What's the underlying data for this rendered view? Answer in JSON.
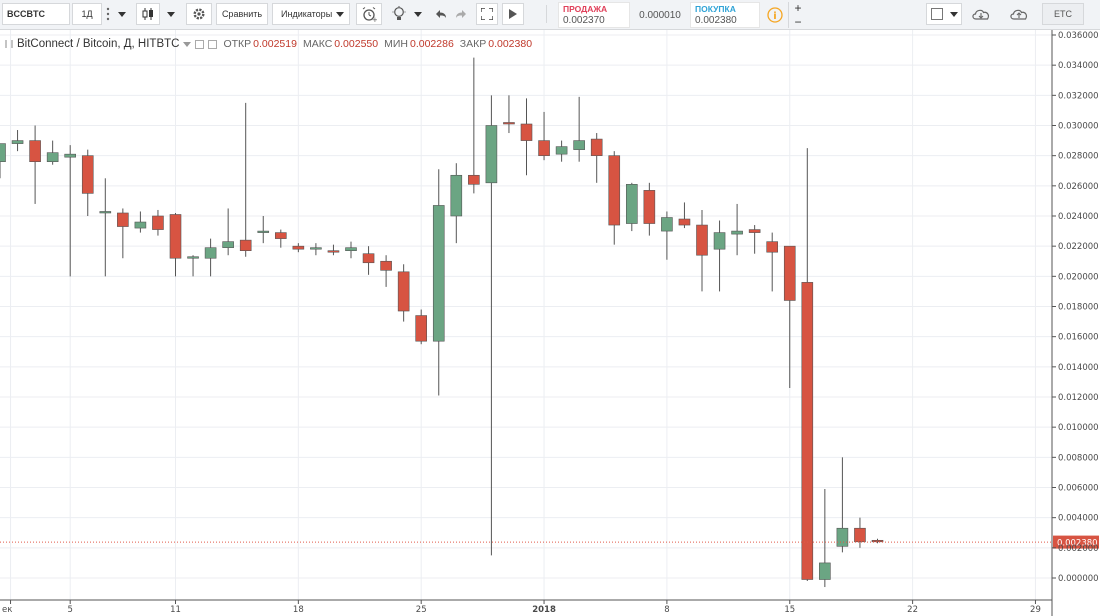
{
  "toolbar": {
    "symbol": "BCCBTC",
    "interval": "1Д",
    "compare_label": "Сравнить",
    "indicators_label": "Индикаторы",
    "sell_label": "ПРОДАЖА",
    "sell_value": "0.002370",
    "spread": "0.000010",
    "buy_label": "ПОКУПКА",
    "buy_value": "0.002380",
    "currency": "ETC",
    "plus": "+",
    "minus": "−"
  },
  "legend": {
    "title": "BitConnect / Bitcoin, Д, HITBTC",
    "open_label": "ОТКР",
    "open_value": "0.002519",
    "high_label": "МАКС",
    "high_value": "0.002550",
    "low_label": "МИН",
    "low_value": "0.002286",
    "close_label": "ЗАКР",
    "close_value": "0.002380"
  },
  "colors": {
    "up": "#6ba583",
    "down": "#d75442",
    "last_price_line": "#e05a4a",
    "grid": "#eceef2"
  },
  "chart_data": {
    "type": "candlestick",
    "title": "BitConnect / Bitcoin, Д, HITBTC",
    "ylim": [
      -0.0005,
      0.0365
    ],
    "y_ticks": [
      "0.036000",
      "0.034000",
      "0.032000",
      "0.030000",
      "0.028000",
      "0.026000",
      "0.024000",
      "0.022000",
      "0.020000",
      "0.018000",
      "0.016000",
      "0.014000",
      "0.012000",
      "0.010000",
      "0.008000",
      "0.006000",
      "0.004000",
      "0.002000",
      "0.000000"
    ],
    "x_ticks": [
      "ек",
      "5",
      "11",
      "18",
      "25",
      "2018",
      "8",
      "15",
      "22",
      "29"
    ],
    "last_price": "0.002380",
    "candles": [
      {
        "o": 0.0276,
        "h": 0.0288,
        "l": 0.0265,
        "c": 0.0288
      },
      {
        "o": 0.0288,
        "h": 0.0297,
        "l": 0.0283,
        "c": 0.029
      },
      {
        "o": 0.029,
        "h": 0.03,
        "l": 0.0248,
        "c": 0.0276
      },
      {
        "o": 0.0276,
        "h": 0.029,
        "l": 0.0274,
        "c": 0.0282
      },
      {
        "o": 0.0279,
        "h": 0.0287,
        "l": 0.02,
        "c": 0.0281
      },
      {
        "o": 0.028,
        "h": 0.0284,
        "l": 0.024,
        "c": 0.0255
      },
      {
        "o": 0.0242,
        "h": 0.0265,
        "l": 0.02,
        "c": 0.0243
      },
      {
        "o": 0.0242,
        "h": 0.0245,
        "l": 0.0212,
        "c": 0.0233
      },
      {
        "o": 0.0232,
        "h": 0.0243,
        "l": 0.0229,
        "c": 0.0236
      },
      {
        "o": 0.024,
        "h": 0.0244,
        "l": 0.0227,
        "c": 0.0231
      },
      {
        "o": 0.0241,
        "h": 0.0242,
        "l": 0.02,
        "c": 0.0212
      },
      {
        "o": 0.0212,
        "h": 0.0214,
        "l": 0.02,
        "c": 0.0213
      },
      {
        "o": 0.0212,
        "h": 0.0225,
        "l": 0.02,
        "c": 0.0219
      },
      {
        "o": 0.0219,
        "h": 0.0245,
        "l": 0.0214,
        "c": 0.0223
      },
      {
        "o": 0.0224,
        "h": 0.0315,
        "l": 0.0213,
        "c": 0.0217
      },
      {
        "o": 0.0229,
        "h": 0.024,
        "l": 0.0222,
        "c": 0.023
      },
      {
        "o": 0.0229,
        "h": 0.0231,
        "l": 0.0219,
        "c": 0.0225
      },
      {
        "o": 0.022,
        "h": 0.0222,
        "l": 0.0216,
        "c": 0.0218
      },
      {
        "o": 0.0218,
        "h": 0.0222,
        "l": 0.0214,
        "c": 0.0219
      },
      {
        "o": 0.0217,
        "h": 0.0221,
        "l": 0.0214,
        "c": 0.0216
      },
      {
        "o": 0.0217,
        "h": 0.0223,
        "l": 0.0212,
        "c": 0.0219
      },
      {
        "o": 0.0215,
        "h": 0.022,
        "l": 0.0201,
        "c": 0.0209
      },
      {
        "o": 0.021,
        "h": 0.0214,
        "l": 0.0193,
        "c": 0.0204
      },
      {
        "o": 0.0203,
        "h": 0.0208,
        "l": 0.017,
        "c": 0.0177
      },
      {
        "o": 0.0174,
        "h": 0.0178,
        "l": 0.0155,
        "c": 0.0157
      },
      {
        "o": 0.0157,
        "h": 0.0271,
        "l": 0.0121,
        "c": 0.0247
      },
      {
        "o": 0.024,
        "h": 0.0275,
        "l": 0.0222,
        "c": 0.0267
      },
      {
        "o": 0.0267,
        "h": 0.0345,
        "l": 0.0255,
        "c": 0.0261
      },
      {
        "o": 0.0262,
        "h": 0.032,
        "l": 0.0015,
        "c": 0.03
      },
      {
        "o": 0.0302,
        "h": 0.032,
        "l": 0.0295,
        "c": 0.0301
      },
      {
        "o": 0.0301,
        "h": 0.0318,
        "l": 0.0267,
        "c": 0.029
      },
      {
        "o": 0.029,
        "h": 0.0309,
        "l": 0.0277,
        "c": 0.028
      },
      {
        "o": 0.0281,
        "h": 0.029,
        "l": 0.0276,
        "c": 0.0286
      },
      {
        "o": 0.0284,
        "h": 0.0319,
        "l": 0.0276,
        "c": 0.029
      },
      {
        "o": 0.0291,
        "h": 0.0295,
        "l": 0.0262,
        "c": 0.028
      },
      {
        "o": 0.028,
        "h": 0.0283,
        "l": 0.0221,
        "c": 0.0234
      },
      {
        "o": 0.0235,
        "h": 0.0262,
        "l": 0.023,
        "c": 0.0261
      },
      {
        "o": 0.0257,
        "h": 0.0262,
        "l": 0.0227,
        "c": 0.0235
      },
      {
        "o": 0.023,
        "h": 0.0243,
        "l": 0.0211,
        "c": 0.0239
      },
      {
        "o": 0.0238,
        "h": 0.0249,
        "l": 0.0232,
        "c": 0.0234
      },
      {
        "o": 0.0234,
        "h": 0.0244,
        "l": 0.019,
        "c": 0.0214
      },
      {
        "o": 0.0218,
        "h": 0.0237,
        "l": 0.019,
        "c": 0.0229
      },
      {
        "o": 0.0228,
        "h": 0.0248,
        "l": 0.0214,
        "c": 0.023
      },
      {
        "o": 0.0231,
        "h": 0.0234,
        "l": 0.0215,
        "c": 0.0229
      },
      {
        "o": 0.0223,
        "h": 0.0229,
        "l": 0.019,
        "c": 0.0216
      },
      {
        "o": 0.022,
        "h": 0.022,
        "l": 0.0126,
        "c": 0.0184
      },
      {
        "o": 0.0196,
        "h": 0.0285,
        "l": -0.0002,
        "c": -0.0001
      },
      {
        "o": -0.0001,
        "h": 0.0059,
        "l": -0.0006,
        "c": 0.001
      },
      {
        "o": 0.0021,
        "h": 0.008,
        "l": 0.0017,
        "c": 0.0033
      },
      {
        "o": 0.0033,
        "h": 0.004,
        "l": 0.002,
        "c": 0.0024
      },
      {
        "o": 0.0025,
        "h": 0.0026,
        "l": 0.0023,
        "c": 0.0024
      }
    ]
  }
}
